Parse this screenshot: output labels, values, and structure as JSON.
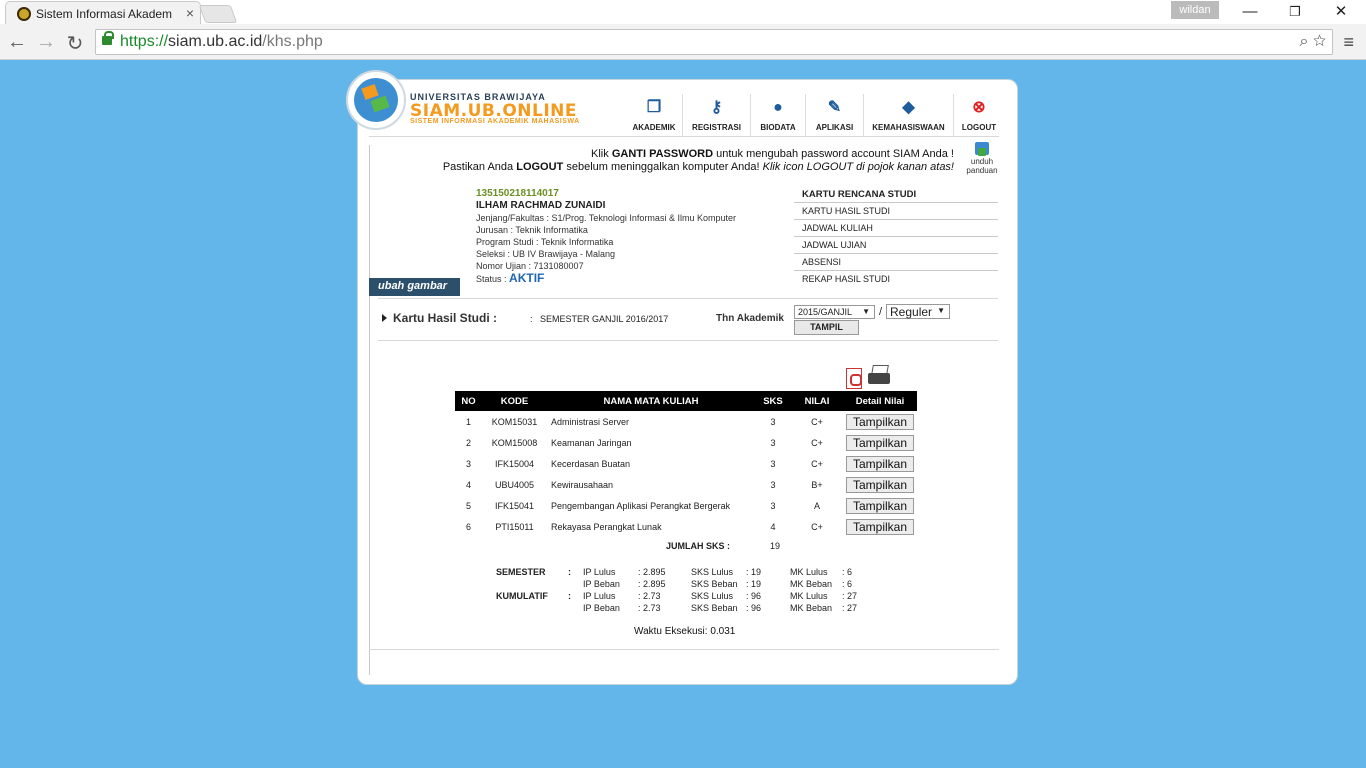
{
  "browser": {
    "tab_title": "Sistem Informasi Akadem",
    "tab_close": "×",
    "user": "wildan",
    "url_scheme": "https://",
    "url_host": "siam.ub.ac.id",
    "url_path": "/khs.php",
    "min": "—",
    "restore": "❐",
    "close": "✕"
  },
  "header": {
    "brand_line1": "UNIVERSITAS BRAWIJAYA",
    "brand_line2": "SIAM.UB.ONLINE",
    "brand_line3": "SISTEM INFORMASI AKADEMIK MAHASISWA",
    "nav": [
      {
        "label": "AKADEMIK",
        "icon": "copy-icon"
      },
      {
        "label": "REGISTRASI",
        "icon": "key-icon"
      },
      {
        "label": "BIODATA",
        "icon": "user-icon"
      },
      {
        "label": "APLIKASI",
        "icon": "wrench-icon"
      },
      {
        "label": "KEMAHASISWAAN",
        "icon": "graduation-cap-icon"
      },
      {
        "label": "LOGOUT",
        "icon": "close-circle-icon"
      }
    ]
  },
  "notice": {
    "line1_a": "Klik ",
    "line1_b": "GANTI PASSWORD",
    "line1_c": " untuk mengubah password account SIAM Anda !",
    "line2_a": "Pastikan Anda ",
    "line2_b": "LOGOUT",
    "line2_c": " sebelum meninggalkan komputer Anda! ",
    "line2_d": "Klik icon LOGOUT di pojok kanan atas!",
    "guide1": "unduh",
    "guide2": "panduan"
  },
  "student": {
    "nim": "135150218114017",
    "name": "ILHAM RACHMAD ZUNAIDI",
    "jenjang": "Jenjang/Fakultas : S1/Prog. Teknologi Informasi & Ilmu Komputer",
    "jurusan": "Jurusan : Teknik Informatika",
    "prodi": "Program Studi : Teknik Informatika",
    "seleksi": "Seleksi : UB IV Brawijaya - Malang",
    "nomor_ujian": "Nomor Ujian : 7131080007",
    "status_label": "Status : ",
    "status": "AKTIF",
    "ubah_gambar": "ubah gambar"
  },
  "side_menu": [
    "KARTU RENCANA STUDI",
    "KARTU HASIL STUDI",
    "JADWAL KULIAH",
    "JADWAL UJIAN",
    "ABSENSI",
    "REKAP HASIL STUDI"
  ],
  "khs": {
    "title": "Kartu Hasil Studi :",
    "colon": ":",
    "semester": "SEMESTER GANJIL 2016/2017",
    "thn_label": "Thn Akademik",
    "thn_value": "2015/GANJIL",
    "slash": "/",
    "program_value": "Reguler",
    "tampil": "TAMPIL",
    "headers": [
      "NO",
      "KODE",
      "NAMA MATA KULIAH",
      "SKS",
      "NILAI",
      "Detail Nilai"
    ],
    "rows": [
      {
        "no": "1",
        "kode": "KOM15031",
        "nama": "Administrasi Server",
        "sks": "3",
        "nilai": "C+"
      },
      {
        "no": "2",
        "kode": "KOM15008",
        "nama": "Keamanan Jaringan",
        "sks": "3",
        "nilai": "C+"
      },
      {
        "no": "3",
        "kode": "IFK15004",
        "nama": "Kecerdasan Buatan",
        "sks": "3",
        "nilai": "C+"
      },
      {
        "no": "4",
        "kode": "UBU4005",
        "nama": "Kewirausahaan",
        "sks": "3",
        "nilai": "B+"
      },
      {
        "no": "5",
        "kode": "IFK15041",
        "nama": "Pengembangan Aplikasi Perangkat Bergerak",
        "sks": "3",
        "nilai": "A"
      },
      {
        "no": "6",
        "kode": "PTI15011",
        "nama": "Rekayasa Perangkat Lunak",
        "sks": "4",
        "nilai": "C+"
      }
    ],
    "detail_button": "Tampilkan",
    "jumlah_label": "JUMLAH SKS   :",
    "jumlah_value": "19"
  },
  "ip": {
    "semester_label": "SEMESTER",
    "kumulatif_label": "KUMULATIF",
    "colon": ":",
    "sem_ip_lulus": "IP Lulus",
    "sem_ip_lulus_v": ": 2.895",
    "sem_ip_beban": "IP Beban",
    "sem_ip_beban_v": ": 2.895",
    "sem_sks_lulus": "SKS Lulus",
    "sem_sks_lulus_v": ": 19",
    "sem_sks_beban": "SKS Beban",
    "sem_sks_beban_v": ": 19",
    "sem_mk_lulus": "MK Lulus",
    "sem_mk_lulus_v": ": 6",
    "sem_mk_beban": "MK Beban",
    "sem_mk_beban_v": ": 6",
    "kum_ip_lulus": "IP Lulus",
    "kum_ip_lulus_v": ": 2.73",
    "kum_ip_beban": "IP Beban",
    "kum_ip_beban_v": ": 2.73",
    "kum_sks_lulus": "SKS Lulus",
    "kum_sks_lulus_v": ": 96",
    "kum_sks_beban": "SKS Beban",
    "kum_sks_beban_v": ": 96",
    "kum_mk_lulus": "MK Lulus",
    "kum_mk_lulus_v": ": 27",
    "kum_mk_beban": "MK Beban",
    "kum_mk_beban_v": ": 27"
  },
  "footer": {
    "eksekusi": "Waktu Eksekusi: 0.031"
  }
}
